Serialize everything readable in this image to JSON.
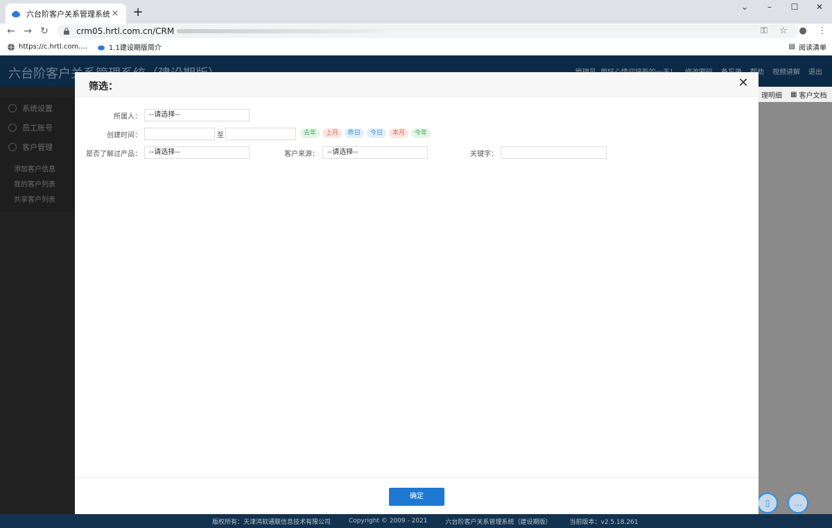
{
  "browser": {
    "tab_title": "六台阶客户关系管理系统（建设期",
    "tab_close": "×",
    "new_tab": "+",
    "url": "crm05.hrtl.com.cn/CRM",
    "win_min": "–",
    "win_max": "☐",
    "win_close": "✕",
    "chevron": "⌄",
    "bookmarks": [
      "https://c.hrtl.com....",
      "1.1建设期版简介"
    ],
    "reading_list": "阅读清单"
  },
  "app": {
    "title": "六台阶客户关系管理系统（建设期版）",
    "header_links": [
      "管理员, 用好心情迎接新的一天！",
      "修改密码",
      "备忘录",
      "帮助",
      "视频讲解",
      "退出"
    ],
    "menu": [
      "系统设置",
      "员工账号",
      "客户管理"
    ],
    "submenu": [
      "添加客户信息",
      "我的客户列表",
      "共享客户列表"
    ],
    "right_tabs": [
      "理明细",
      "客户文档"
    ],
    "footer": [
      "版权所有：天津鸿软通联信息技术有限公司",
      "Copyright © 2009 - 2021",
      "六台阶客户关系管理系统（建设期版）",
      "当前版本：v2.5.18.261"
    ]
  },
  "modal": {
    "title": "筛选：",
    "close": "✕",
    "owner_label": "所属人：",
    "owner_value": "--请选择--",
    "created_label": "创建时间：",
    "to_label": "至",
    "quick_tags": [
      {
        "label": "去年",
        "color": "#3aa85a",
        "bg": "#e3f4e8"
      },
      {
        "label": "上月",
        "color": "#e0684a",
        "bg": "#fbe6e1"
      },
      {
        "label": "昨日",
        "color": "#3a8ad8",
        "bg": "#e2eefa"
      },
      {
        "label": "今日",
        "color": "#3a8ad8",
        "bg": "#e2eefa"
      },
      {
        "label": "本月",
        "color": "#e0684a",
        "bg": "#fbe6e1"
      },
      {
        "label": "今年",
        "color": "#3aa85a",
        "bg": "#e3f4e8"
      }
    ],
    "product_label": "是否了解过产品：",
    "product_value": "--请选择--",
    "source_label": "客户来源：",
    "source_value": "--请选择--",
    "keyword_label": "关键字：",
    "keyword_value": "",
    "confirm": "确定"
  }
}
